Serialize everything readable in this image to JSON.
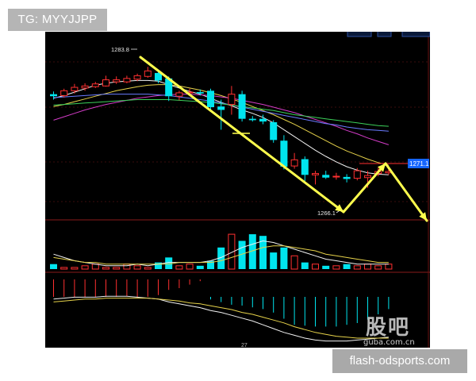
{
  "watermarks": {
    "top_left": "TG: MYYJJPP",
    "bottom_right": "flash-odsports.com",
    "logo": "股吧",
    "logo_sub": "guba.com.cn"
  },
  "chart_data": {
    "type": "candlestick",
    "ylim": [
      1262,
      1288
    ],
    "annotations": {
      "high": "1283.8",
      "low": "1266.1",
      "target": "1271.1"
    },
    "x_tick": "27",
    "colors": {
      "up": "#ff3030",
      "down": "#00e5ee",
      "arrow": "#ffff4d",
      "price_box": "#1565ff"
    },
    "candles": [
      {
        "o": 1279.8,
        "h": 1280.2,
        "l": 1279.0,
        "c": 1279.5
      },
      {
        "o": 1279.6,
        "h": 1280.6,
        "l": 1279.3,
        "c": 1280.3
      },
      {
        "o": 1280.3,
        "h": 1281.3,
        "l": 1279.9,
        "c": 1280.8
      },
      {
        "o": 1280.7,
        "h": 1281.4,
        "l": 1280.3,
        "c": 1281.0
      },
      {
        "o": 1280.9,
        "h": 1281.6,
        "l": 1280.7,
        "c": 1281.3
      },
      {
        "o": 1281.0,
        "h": 1282.5,
        "l": 1280.9,
        "c": 1281.9
      },
      {
        "o": 1281.6,
        "h": 1282.4,
        "l": 1281.3,
        "c": 1281.9
      },
      {
        "o": 1281.6,
        "h": 1282.5,
        "l": 1281.4,
        "c": 1282.1
      },
      {
        "o": 1282.0,
        "h": 1282.8,
        "l": 1281.7,
        "c": 1282.5
      },
      {
        "o": 1282.4,
        "h": 1283.8,
        "l": 1282.2,
        "c": 1283.2
      },
      {
        "o": 1282.9,
        "h": 1283.2,
        "l": 1281.4,
        "c": 1281.8
      },
      {
        "o": 1282.1,
        "h": 1282.4,
        "l": 1278.8,
        "c": 1279.5
      },
      {
        "o": 1279.5,
        "h": 1280.3,
        "l": 1278.9,
        "c": 1280.0
      },
      {
        "o": 1280.0,
        "h": 1280.6,
        "l": 1279.7,
        "c": 1280.1
      },
      {
        "o": 1280.1,
        "h": 1280.5,
        "l": 1279.6,
        "c": 1279.9
      },
      {
        "o": 1280.3,
        "h": 1280.6,
        "l": 1277.5,
        "c": 1277.9
      },
      {
        "o": 1278.0,
        "h": 1279.0,
        "l": 1274.6,
        "c": 1277.5
      },
      {
        "o": 1278.3,
        "h": 1281.0,
        "l": 1276.8,
        "c": 1279.8
      },
      {
        "o": 1279.8,
        "h": 1280.3,
        "l": 1275.8,
        "c": 1276.2
      },
      {
        "o": 1276.2,
        "h": 1276.6,
        "l": 1275.8,
        "c": 1276.0
      },
      {
        "o": 1276.2,
        "h": 1276.8,
        "l": 1275.4,
        "c": 1275.8
      },
      {
        "o": 1275.7,
        "h": 1276.0,
        "l": 1272.7,
        "c": 1273.1
      },
      {
        "o": 1273.0,
        "h": 1273.8,
        "l": 1268.8,
        "c": 1269.2
      },
      {
        "o": 1269.3,
        "h": 1271.2,
        "l": 1268.9,
        "c": 1270.2
      },
      {
        "o": 1270.3,
        "h": 1270.7,
        "l": 1267.1,
        "c": 1268.0
      },
      {
        "o": 1268.0,
        "h": 1268.6,
        "l": 1266.6,
        "c": 1268.2
      },
      {
        "o": 1268.0,
        "h": 1268.6,
        "l": 1267.4,
        "c": 1267.6
      },
      {
        "o": 1267.7,
        "h": 1268.3,
        "l": 1267.3,
        "c": 1267.8
      },
      {
        "o": 1267.7,
        "h": 1268.1,
        "l": 1266.9,
        "c": 1267.4
      },
      {
        "o": 1267.5,
        "h": 1269.0,
        "l": 1267.2,
        "c": 1268.6
      },
      {
        "o": 1267.6,
        "h": 1268.6,
        "l": 1266.1,
        "c": 1267.9
      },
      {
        "o": 1268.2,
        "h": 1269.0,
        "l": 1267.8,
        "c": 1268.5
      },
      {
        "o": 1268.3,
        "h": 1268.8,
        "l": 1268.0,
        "c": 1268.5
      }
    ],
    "ma_lines": [
      {
        "color": "#f2f2f2",
        "values": [
          1279.2,
          1279.6,
          1280.1,
          1280.6,
          1281.1,
          1281.4,
          1281.6,
          1281.7,
          1281.8,
          1281.8,
          1281.7,
          1281.2,
          1280.7,
          1280.2,
          1279.8,
          1279.2,
          1278.6,
          1278.1,
          1277.5,
          1277.0,
          1276.4,
          1275.6,
          1274.6,
          1273.6,
          1272.6,
          1271.6,
          1270.7,
          1269.9,
          1269.2,
          1268.7,
          1268.3,
          1268.1,
          1268.0
        ]
      },
      {
        "color": "#e6d24a",
        "values": [
          1278.0,
          1278.3,
          1278.7,
          1279.1,
          1279.5,
          1279.9,
          1280.3,
          1280.6,
          1280.9,
          1281.1,
          1281.2,
          1281.2,
          1281.0,
          1280.7,
          1280.4,
          1280.0,
          1279.6,
          1279.1,
          1278.6,
          1278.0,
          1277.4,
          1276.8,
          1276.1,
          1275.4,
          1274.6,
          1273.8,
          1273.0,
          1272.2,
          1271.5,
          1270.9,
          1270.3,
          1269.8,
          1269.4
        ]
      },
      {
        "color": "#d43cc8",
        "values": [
          1276.0,
          1276.5,
          1277.0,
          1277.5,
          1277.9,
          1278.3,
          1278.6,
          1278.9,
          1279.2,
          1279.4,
          1279.6,
          1279.7,
          1279.8,
          1279.8,
          1279.7,
          1279.6,
          1279.4,
          1279.2,
          1278.9,
          1278.6,
          1278.3,
          1277.9,
          1277.5,
          1277.1,
          1276.6,
          1276.1,
          1275.6,
          1275.1,
          1274.5,
          1274.0,
          1273.4,
          1272.9,
          1272.4
        ]
      },
      {
        "color": "#6a7bff",
        "values": [
          1279.3,
          1279.4,
          1279.5,
          1279.6,
          1279.7,
          1279.8,
          1279.8,
          1279.8,
          1279.8,
          1279.8,
          1279.7,
          1279.6,
          1279.4,
          1279.2,
          1279.0,
          1278.8,
          1278.5,
          1278.2,
          1277.9,
          1277.6,
          1277.3,
          1277.0,
          1276.7,
          1276.4,
          1276.1,
          1275.8,
          1275.5,
          1275.3,
          1275.0,
          1274.8,
          1274.6,
          1274.5,
          1274.4
        ]
      },
      {
        "color": "#3cd15a",
        "values": [
          1278.2,
          1278.3,
          1278.4,
          1278.5,
          1278.6,
          1278.7,
          1278.8,
          1278.9,
          1279.0,
          1279.0,
          1279.0,
          1279.0,
          1278.9,
          1278.8,
          1278.7,
          1278.6,
          1278.4,
          1278.2,
          1278.0,
          1277.8,
          1277.6,
          1277.4,
          1277.1,
          1276.8,
          1276.6,
          1276.4,
          1276.2,
          1276.0,
          1275.8,
          1275.6,
          1275.4,
          1275.2,
          1275.1
        ]
      }
    ],
    "volume": [
      3,
      1,
      1,
      2,
      3,
      1,
      1,
      3,
      2,
      1,
      4,
      7,
      2,
      3,
      2,
      5,
      13,
      21,
      17,
      21,
      20,
      10,
      13,
      8,
      4,
      3,
      2,
      2,
      3,
      2,
      3,
      2,
      3
    ],
    "volume_ma": [
      {
        "color": "#f2f2f2",
        "values": [
          9,
          7,
          5,
          4,
          3,
          2,
          2,
          2,
          3,
          2,
          3,
          4,
          4,
          4,
          4,
          5,
          7,
          10,
          13,
          15,
          17,
          16,
          14,
          12,
          10,
          8,
          6,
          5,
          4,
          3,
          3,
          3,
          3
        ]
      },
      {
        "color": "#e6d24a",
        "values": [
          7,
          6,
          5,
          4,
          4,
          3,
          3,
          3,
          3,
          3,
          3,
          3,
          4,
          4,
          4,
          4,
          5,
          7,
          9,
          11,
          13,
          14,
          14,
          13,
          12,
          11,
          9,
          8,
          7,
          6,
          5,
          4,
          4
        ]
      }
    ],
    "macd": [
      -2.0,
      -2.0,
      -2.0,
      -2.0,
      -2.0,
      -2.0,
      -2.0,
      -1.9,
      -2.0,
      -2.0,
      -1.8,
      -1.2,
      -1.0,
      -0.6,
      -0.2,
      0.3,
      0.6,
      0.9,
      1.0,
      1.2,
      1.4,
      1.8,
      2.5,
      3.2,
      3.3,
      3.4,
      3.4,
      3.4,
      3.2,
      3.0,
      2.6,
      2.0,
      1.4
    ],
    "macd_lines": [
      {
        "color": "#f2f2f2",
        "values": [
          -0.6,
          -0.7,
          -0.8,
          -0.8,
          -0.8,
          -0.9,
          -0.9,
          -0.9,
          -0.8,
          -0.7,
          -0.6,
          -0.3,
          -0.1,
          0.1,
          0.3,
          0.6,
          0.8,
          1.1,
          1.4,
          1.7,
          2.1,
          2.5,
          2.9,
          3.2,
          3.5,
          3.7,
          3.8,
          3.8,
          3.8,
          3.7,
          3.6,
          3.5,
          3.4
        ]
      },
      {
        "color": "#e6d24a",
        "values": [
          -0.3,
          -0.4,
          -0.5,
          -0.6,
          -0.6,
          -0.7,
          -0.7,
          -0.7,
          -0.7,
          -0.7,
          -0.6,
          -0.5,
          -0.4,
          -0.2,
          -0.1,
          0.1,
          0.3,
          0.5,
          0.8,
          1.0,
          1.3,
          1.6,
          1.9,
          2.3,
          2.6,
          2.9,
          3.1,
          3.3,
          3.4,
          3.5,
          3.5,
          3.5,
          3.5
        ]
      }
    ]
  }
}
